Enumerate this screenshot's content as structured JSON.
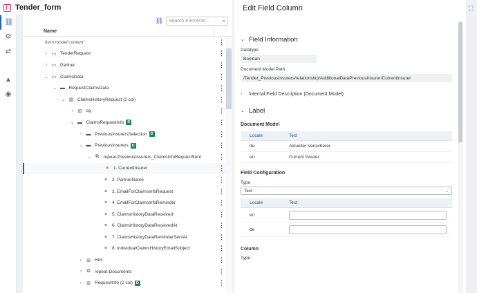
{
  "app": {
    "title": "Tender_form",
    "logo_letter": "F"
  },
  "vnav": [
    {
      "name": "structure-icon",
      "glyph": "⛓"
    },
    {
      "name": "gear-icon",
      "glyph": "⚙"
    },
    {
      "name": "swap-icon",
      "glyph": "⇄"
    },
    {
      "name": "rules-icon",
      "glyph": "▲"
    },
    {
      "name": "eye-icon",
      "glyph": "◉"
    }
  ],
  "tree": {
    "search_placeholder": "Search Elements...",
    "column_name": "Name",
    "rows": [
      {
        "indent": 0,
        "chev": "",
        "icon": "",
        "label": "form model content",
        "italic": true,
        "badge": ""
      },
      {
        "indent": 1,
        "chev": "›",
        "icon": "▭",
        "label": "TenderRequest",
        "badge": ""
      },
      {
        "indent": 1,
        "chev": "›",
        "icon": "▭",
        "label": "Partner",
        "badge": ""
      },
      {
        "indent": 1,
        "chev": "⌄",
        "icon": "▭",
        "label": "ClaimsData",
        "badge": ""
      },
      {
        "indent": 2,
        "chev": "⌄",
        "icon": "▬",
        "label": "RequestClaimsData",
        "badge": ""
      },
      {
        "indent": 3,
        "chev": "⌄",
        "icon": "▥",
        "label": "ClaimsHistoryRequest (2 col)",
        "badge": ""
      },
      {
        "indent": 4,
        "chev": "›",
        "icon": "⊞",
        "label": "cg",
        "badge": ""
      },
      {
        "indent": 4,
        "chev": "⌄",
        "icon": "▬",
        "label": "ClaimsRequestInfo",
        "badge": "D"
      },
      {
        "indent": 5,
        "chev": "›",
        "icon": "▬",
        "label": "PreviousInsurersSelection",
        "badge": "D"
      },
      {
        "indent": 5,
        "chev": "⌄",
        "icon": "▬",
        "label": "PreviousInsurers",
        "badge": "D"
      },
      {
        "indent": 6,
        "chev": "⌄",
        "icon": "⧉",
        "label": "repeat-PreviousInsurers_ClaimsInfoRequestSent",
        "badge": ""
      },
      {
        "indent": 7,
        "chev": "",
        "icon": "≡",
        "label": "1. CurrentInsurer",
        "badge": "",
        "selected": true
      },
      {
        "indent": 7,
        "chev": "",
        "icon": "≡",
        "label": "2. PartnerName",
        "badge": ""
      },
      {
        "indent": 7,
        "chev": "",
        "icon": "≡",
        "label": "3. EmailForClaimsInfoRequest",
        "badge": ""
      },
      {
        "indent": 7,
        "chev": "",
        "icon": "≡",
        "label": "4. EmailForClaimsInfoReminder",
        "badge": ""
      },
      {
        "indent": 7,
        "chev": "",
        "icon": "≡",
        "label": "5. ClaimsHistoryDataReceived",
        "badge": ""
      },
      {
        "indent": 7,
        "chev": "",
        "icon": "≡",
        "label": "6. ClaimsHistoryDataReceivedAt",
        "badge": ""
      },
      {
        "indent": 7,
        "chev": "",
        "icon": "≡",
        "label": "7. ClaimsHistoryDataReminderSentAt",
        "badge": ""
      },
      {
        "indent": 7,
        "chev": "",
        "icon": "≡",
        "label": "8. IndividualClaimsHistoryEmailSubject",
        "badge": ""
      },
      {
        "indent": 5,
        "chev": "›",
        "icon": "⊞",
        "label": "Hint",
        "badge": ""
      },
      {
        "indent": 5,
        "chev": "›",
        "icon": "⧉",
        "label": "repeat-Documents",
        "badge": ""
      },
      {
        "indent": 5,
        "chev": "›",
        "icon": "⊞",
        "label": "RequestInfo (2 col)",
        "badge": "D"
      }
    ]
  },
  "editor": {
    "title": "Edit Field Column",
    "field_information": "Field Information",
    "datatype_label": "Datatype",
    "datatype_value": "Boolean",
    "doc_model_path_label": "Document Model Path",
    "doc_model_path_value": "/Tender_PreviousInsurers/relationship/AdditionalDataPreviousInsurer/CurrentInsurer",
    "internal_desc": "Internal Field Description (Document Model)",
    "label_section": "Label",
    "document_model": "Document Model",
    "locale_header": "Locale",
    "text_header": "Text",
    "label_rows": [
      {
        "locale": "de",
        "text": "Aktueller Versicherer"
      },
      {
        "locale": "en",
        "text": "Current Insurer"
      }
    ],
    "field_configuration": "Field Configuration",
    "type_label": "Type",
    "type_value": "Text",
    "config_rows": [
      {
        "locale": "en",
        "text": ""
      },
      {
        "locale": "de",
        "text": ""
      }
    ],
    "column_label": "Column",
    "column_type_label": "Type"
  }
}
